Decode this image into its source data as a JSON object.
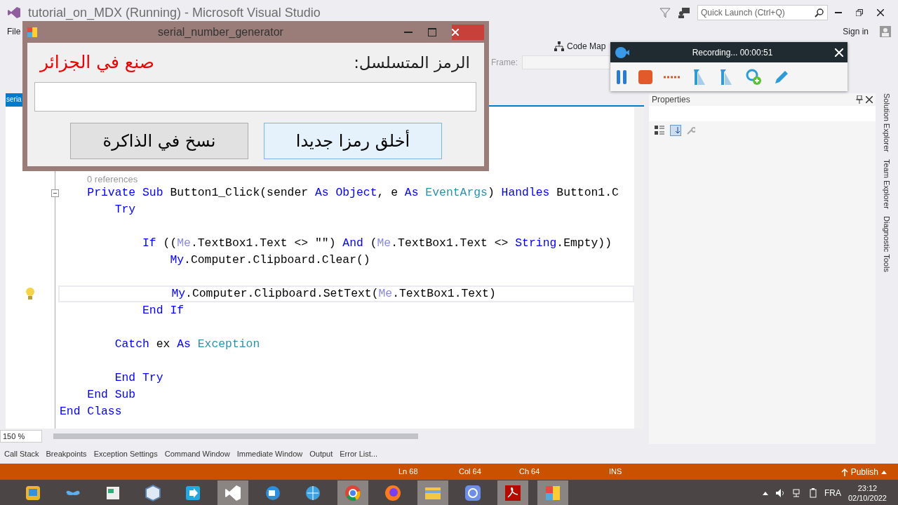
{
  "window": {
    "title": "tutorial_on_MDX (Running) - Microsoft Visual Studio"
  },
  "quick_launch": {
    "placeholder": "Quick Launch (Ctrl+Q)"
  },
  "menu": [
    "File"
  ],
  "account": {
    "label": "Sign in"
  },
  "toolbar": {
    "code_map": "Code Map",
    "frame_label": "Frame:"
  },
  "document_tab": {
    "label": "seria",
    "selected": true
  },
  "editor": {
    "references": "0 references",
    "lines": [
      {
        "kind": "code",
        "collapsible": true,
        "current": false,
        "tokens": [
          {
            "text": "    Private Sub",
            "kind": "keyword"
          },
          {
            "text": " Button1_Click(sender "
          },
          {
            "text": "As Object",
            "kind": "keyword"
          },
          {
            "text": ", e "
          },
          {
            "text": "As",
            "kind": "keyword"
          },
          {
            "text": " EventArgs",
            "kind": "type"
          },
          {
            "text": ") "
          },
          {
            "text": "Handles",
            "kind": "keyword"
          },
          {
            "text": " Button1.C"
          }
        ]
      },
      {
        "kind": "code",
        "collapsible": false,
        "current": false,
        "tokens": [
          {
            "text": "        Try",
            "kind": "keyword"
          }
        ]
      },
      {
        "kind": "blank"
      },
      {
        "kind": "code",
        "collapsible": false,
        "current": false,
        "tokens": [
          {
            "text": "            If",
            "kind": "keyword"
          },
          {
            "text": " (("
          },
          {
            "text": "Me",
            "kind": "me"
          },
          {
            "text": ".TextBox1.Text <> \"\") "
          },
          {
            "text": "And",
            "kind": "keyword"
          },
          {
            "text": " ("
          },
          {
            "text": "Me",
            "kind": "me"
          },
          {
            "text": ".TextBox1.Text <> "
          },
          {
            "text": "String",
            "kind": "keyword"
          },
          {
            "text": ".Empty))"
          }
        ]
      },
      {
        "kind": "code",
        "collapsible": false,
        "current": false,
        "tokens": [
          {
            "text": "                My",
            "kind": "keyword"
          },
          {
            "text": ".Computer.Clipboard.Clear()"
          }
        ]
      },
      {
        "kind": "blank"
      },
      {
        "kind": "code",
        "collapsible": false,
        "current": true,
        "tokens": [
          {
            "text": "                My",
            "kind": "keyword"
          },
          {
            "text": ".Computer.Clipboard.SetText("
          },
          {
            "text": "Me",
            "kind": "me"
          },
          {
            "text": ".TextBox1.Text)"
          }
        ]
      },
      {
        "kind": "code",
        "collapsible": false,
        "current": false,
        "tokens": [
          {
            "text": "            End If",
            "kind": "keyword"
          }
        ]
      },
      {
        "kind": "blank"
      },
      {
        "kind": "code",
        "collapsible": false,
        "current": false,
        "tokens": [
          {
            "text": "        Catch",
            "kind": "keyword"
          },
          {
            "text": " ex "
          },
          {
            "text": "As",
            "kind": "keyword"
          },
          {
            "text": " Exception",
            "kind": "type"
          }
        ]
      },
      {
        "kind": "blank"
      },
      {
        "kind": "code",
        "collapsible": false,
        "current": false,
        "tokens": [
          {
            "text": "        End Try",
            "kind": "keyword"
          }
        ]
      },
      {
        "kind": "code",
        "collapsible": false,
        "current": false,
        "tokens": [
          {
            "text": "    End Sub",
            "kind": "keyword"
          }
        ]
      },
      {
        "kind": "code",
        "collapsible": false,
        "current": false,
        "tokens": [
          {
            "text": "End Class",
            "kind": "keyword"
          }
        ]
      }
    ],
    "zoom": "150 %"
  },
  "properties": {
    "title": "Properties"
  },
  "side_tabs": [
    "Solution Explorer",
    "Team Explorer",
    "Diagnostic Tools"
  ],
  "bottom_tabs": [
    "Call Stack",
    "Breakpoints",
    "Exception Settings",
    "Command Window",
    "Immediate Window",
    "Output",
    "Error List..."
  ],
  "status_bar": {
    "ln": "Ln 68",
    "col": "Col 64",
    "ch": "Ch 64",
    "mode": "INS",
    "publish": "Publish"
  },
  "taskbar": {
    "apps": [
      {
        "kind": "desktop",
        "running": false
      },
      {
        "kind": "infinity",
        "running": false
      },
      {
        "kind": "document",
        "running": false
      },
      {
        "kind": "cube",
        "running": false
      },
      {
        "kind": "arrow",
        "running": false
      },
      {
        "kind": "studio",
        "running": true
      },
      {
        "kind": "camera",
        "running": false
      },
      {
        "kind": "globe",
        "running": false
      },
      {
        "kind": "chrome",
        "running": true
      },
      {
        "kind": "firefox",
        "running": false
      },
      {
        "kind": "folder",
        "running": true
      },
      {
        "kind": "sync",
        "running": false
      },
      {
        "kind": "pdf",
        "running": true
      },
      {
        "kind": "app",
        "running": true
      }
    ],
    "language": "FRA",
    "time": "23:12",
    "date": "02/10/2022"
  },
  "dialog": {
    "title": "serial_number_generator",
    "serial_label": "الرمز المتسلسل:",
    "made_in": "صنع في الجزائر",
    "buttons": [
      {
        "label": "أخلق رمزا جديدا",
        "hovered": true
      },
      {
        "label": "نسخ في الذاكرة",
        "hovered": false
      }
    ]
  },
  "recorder": {
    "status": "Recording... 00:00:51"
  }
}
